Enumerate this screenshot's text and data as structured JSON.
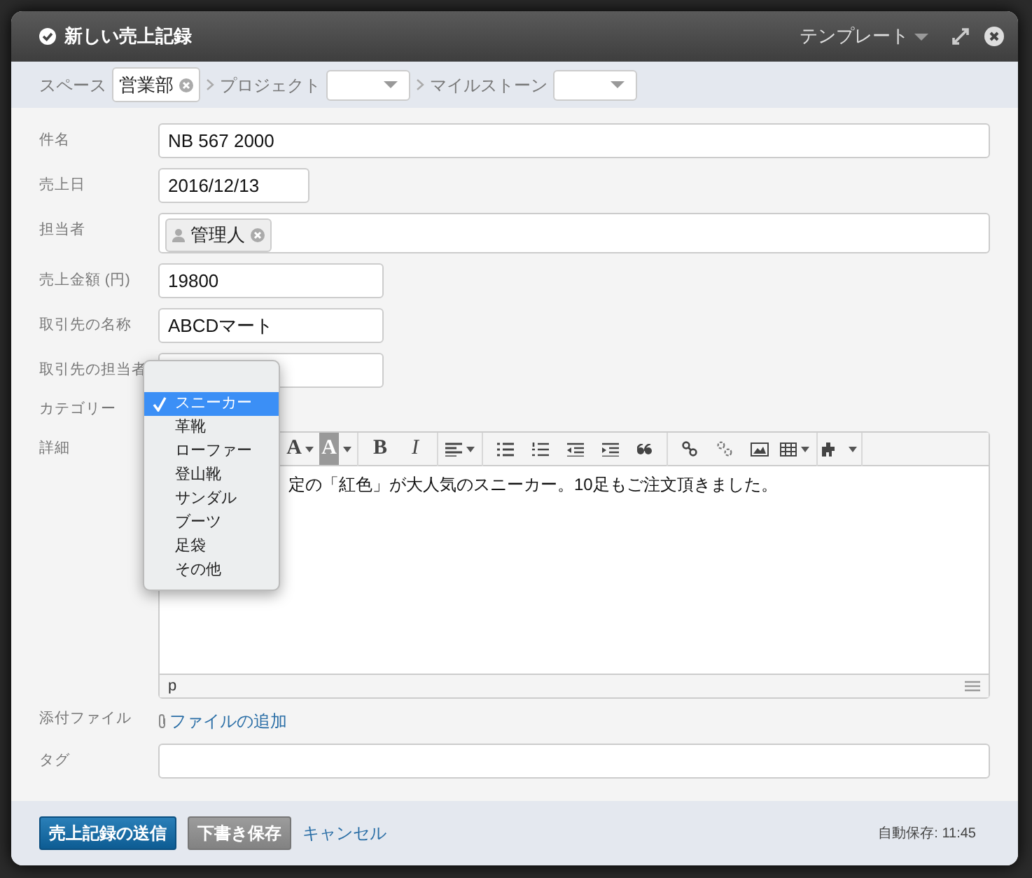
{
  "dialog": {
    "title": "新しい売上記録",
    "template_menu": "テンプレート"
  },
  "context": [
    {
      "label": "スペース",
      "kind": "tag",
      "value": "営業部"
    },
    {
      "label": "プロジェクト",
      "kind": "select"
    },
    {
      "label": "マイルストーン",
      "kind": "select"
    }
  ],
  "fields": [
    {
      "label": "件名",
      "kind": "text",
      "value": "NB 567 2000"
    },
    {
      "label": "売上日",
      "kind": "date",
      "value": "2016/12/13"
    },
    {
      "label": "担当者",
      "kind": "user",
      "value": "管理人"
    },
    {
      "label": "売上金額 (円)",
      "kind": "number",
      "value": "19800"
    },
    {
      "label": "取引先の名称",
      "kind": "text",
      "value": "ABCDマート"
    },
    {
      "label": "取引先の担当者",
      "kind": "text"
    },
    {
      "label": "カテゴリー",
      "kind": "category",
      "options": [
        {
          "label": "スニーカー",
          "selected": true
        },
        {
          "label": "革靴",
          "selected": false
        },
        {
          "label": "ローファー",
          "selected": false
        },
        {
          "label": "登山靴",
          "selected": false
        },
        {
          "label": "サンダル",
          "selected": false
        },
        {
          "label": "ブーツ",
          "selected": false
        },
        {
          "label": "足袋",
          "selected": false
        },
        {
          "label": "その他",
          "selected": false
        }
      ]
    },
    {
      "label": "詳細",
      "kind": "editor",
      "text": "定の「紅色」が大人気のスニーカー。10足もご注文頂きました。",
      "status": "p",
      "toolbar": [
        {
          "kind": "color",
          "label": "A"
        },
        {
          "kind": "highlight",
          "label": "A"
        },
        {
          "kind": "sep"
        },
        {
          "kind": "bold",
          "label": "B"
        },
        {
          "kind": "italic",
          "label": "I"
        },
        {
          "kind": "sep"
        },
        {
          "kind": "align"
        },
        {
          "kind": "sep"
        },
        {
          "kind": "ul"
        },
        {
          "kind": "ol"
        },
        {
          "kind": "outdent"
        },
        {
          "kind": "indent"
        },
        {
          "kind": "quote"
        },
        {
          "kind": "sep"
        },
        {
          "kind": "link"
        },
        {
          "kind": "unlink"
        },
        {
          "kind": "image"
        },
        {
          "kind": "table"
        },
        {
          "kind": "sep"
        },
        {
          "kind": "plugin"
        },
        {
          "kind": "sep"
        }
      ]
    },
    {
      "label": "添付ファイル",
      "kind": "attach",
      "link": "ファイルの追加"
    },
    {
      "label": "タグ",
      "kind": "text"
    }
  ],
  "footer": {
    "submit": "売上記録の送信",
    "draft": "下書き保存",
    "cancel": "キャンセル",
    "autosave": "自動保存: 11:45"
  }
}
